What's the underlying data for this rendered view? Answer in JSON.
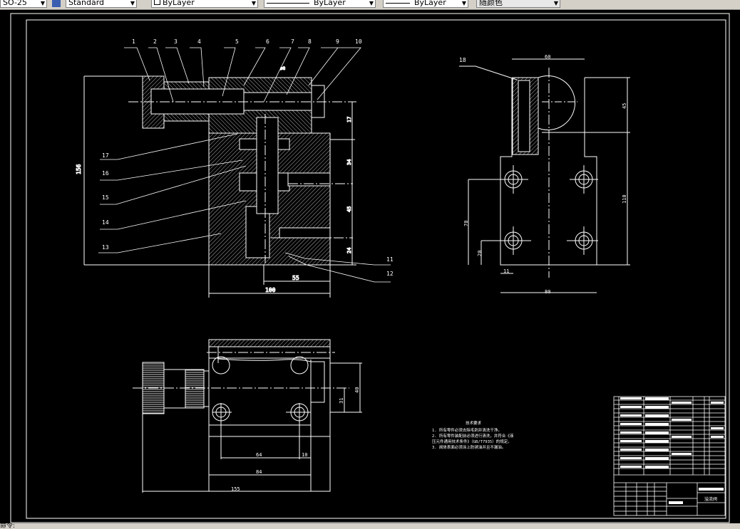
{
  "toolbar": {
    "dimstyle": "SO-25",
    "textstyle": "Standard",
    "layer": "ByLayer",
    "linetype": "ByLayer",
    "lineweight": "ByLayer",
    "plotstyle": "随颜色"
  },
  "drawing": {
    "front_labels": [
      "1",
      "2",
      "3",
      "4",
      "5",
      "6",
      "7",
      "8",
      "9",
      "10",
      "11",
      "12",
      "13",
      "14",
      "15",
      "16",
      "17"
    ],
    "side_label": "18",
    "front_dims": {
      "height": "156",
      "width": "100",
      "offset": "55",
      "d1": "17",
      "d2": "34",
      "d3": "45",
      "d4": "24",
      "tol": "ø8"
    },
    "side_dims": {
      "top": "60",
      "bottom": "80",
      "upper": "45",
      "lower": "110",
      "v1": "70",
      "v2": "20",
      "h1": "11"
    },
    "top_dims": {
      "d64": "64",
      "d10": "10",
      "d84": "84",
      "d155": "155",
      "d40": "40",
      "d31": "31"
    },
    "notes": {
      "title": "技术要求",
      "lines": [
        "1. 所有零件必须去除毛刺并清洗干净。",
        "2. 所有零件装配前必须进行清洗，并符合《液",
        "   压元件通用技术条件》（GB/T7935）的规定。",
        "3. 阀体表面必须涂上防锈油并且不漏油。"
      ]
    },
    "title_block": {
      "name": "溢流阀"
    }
  },
  "status": {
    "command": "命令:"
  },
  "colors": {
    "background": "#000000",
    "lines": "#ffffff",
    "toolbar": "#d4d0c8"
  }
}
